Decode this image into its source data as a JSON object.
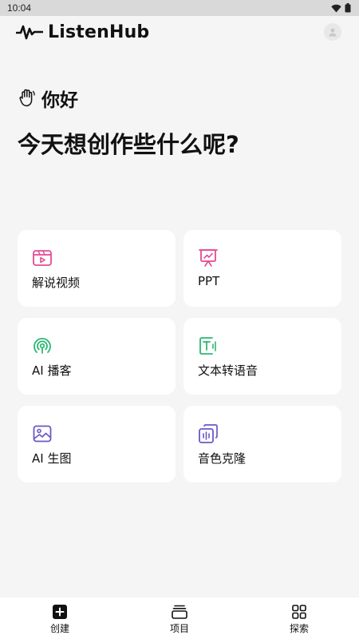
{
  "status_bar": {
    "time": "10:04"
  },
  "header": {
    "brand": "ListenHub"
  },
  "greeting": {
    "text": "你好"
  },
  "headline": {
    "text": "今天想创作些什么呢?"
  },
  "cards": [
    {
      "label": "解说视频",
      "icon": "video-icon",
      "color": "#e44a96"
    },
    {
      "label": "PPT",
      "icon": "presentation-icon",
      "color": "#e44a96"
    },
    {
      "label": "AI 播客",
      "icon": "podcast-icon",
      "color": "#2bb673"
    },
    {
      "label": "文本转语音",
      "icon": "text-to-speech-icon",
      "color": "#2bb673"
    },
    {
      "label": "AI 生图",
      "icon": "image-icon",
      "color": "#6a58c9"
    },
    {
      "label": "音色克隆",
      "icon": "voice-clone-icon",
      "color": "#6a58c9"
    }
  ],
  "bottom_nav": [
    {
      "label": "创建",
      "icon": "plus-square-icon"
    },
    {
      "label": "项目",
      "icon": "stack-icon"
    },
    {
      "label": "探索",
      "icon": "grid-icon"
    }
  ]
}
